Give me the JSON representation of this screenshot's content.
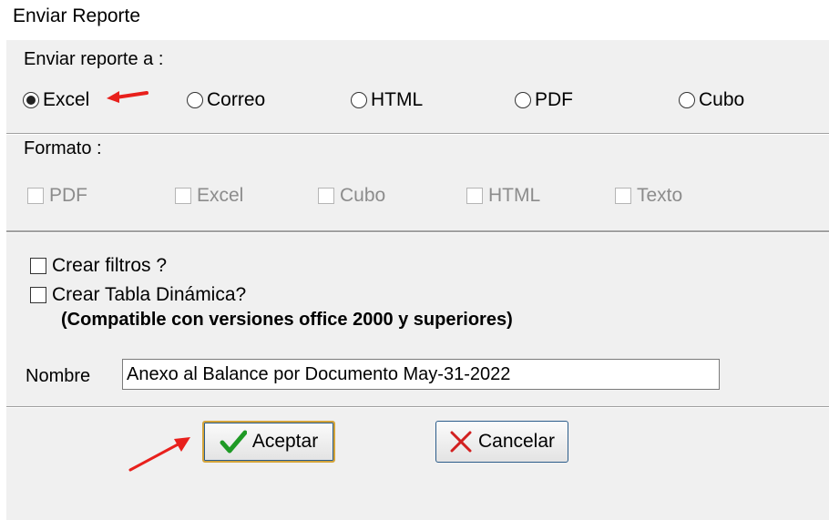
{
  "window": {
    "title": "Enviar Reporte"
  },
  "send_to": {
    "label": "Enviar reporte a :",
    "options": [
      {
        "label": "Excel",
        "selected": true
      },
      {
        "label": "Correo",
        "selected": false
      },
      {
        "label": "HTML",
        "selected": false
      },
      {
        "label": "PDF",
        "selected": false
      },
      {
        "label": "Cubo",
        "selected": false
      }
    ]
  },
  "format": {
    "label": "Formato :",
    "options": [
      {
        "label": "PDF",
        "checked": false,
        "enabled": false
      },
      {
        "label": "Excel",
        "checked": false,
        "enabled": false
      },
      {
        "label": "Cubo",
        "checked": false,
        "enabled": false
      },
      {
        "label": "HTML",
        "checked": false,
        "enabled": false
      },
      {
        "label": "Texto",
        "checked": false,
        "enabled": false
      }
    ]
  },
  "options": {
    "crear_filtros": {
      "label": "Crear filtros ?",
      "checked": false
    },
    "crear_tabla": {
      "label": "Crear Tabla Dinámica?",
      "checked": false
    },
    "compat_note": "(Compatible con versiones office 2000 y superiores)"
  },
  "nombre": {
    "label": "Nombre",
    "value": "Anexo al Balance por Documento  May-31-2022"
  },
  "buttons": {
    "accept": "Aceptar",
    "cancel": "Cancelar"
  },
  "colors": {
    "annotation_arrow": "#e8201c",
    "check_icon": "#1f9a25",
    "cancel_icon": "#d22020",
    "default_button_border": "#d4a43a"
  }
}
